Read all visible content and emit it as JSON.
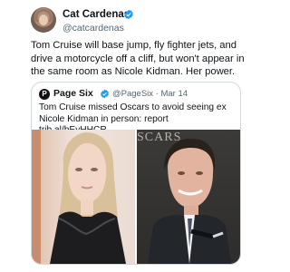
{
  "tweet": {
    "author_name": "Cat Cardenas",
    "author_handle": "@catcardenas",
    "text": "Tom Cruise will base jump, fly fighter jets, and drive a motorcycle off a cliff, but won't appear in the same room as Nicole Kidman. Her power."
  },
  "quoted_tweet": {
    "source_name": "Page Six",
    "source_logo_text": "P",
    "source_handle_time": "@PageSix · Mar 14",
    "text": "Tom Cruise missed Oscars to avoid seeing ex Nicole Kidman in person: report trib.al/bEyHHCR",
    "media_background_text": "SCARS"
  },
  "icons": {
    "verified": "verified-badge-icon"
  },
  "colors": {
    "verified_blue": "#1d9bf0",
    "secondary_text": "#536471",
    "border": "#cfd9de"
  }
}
